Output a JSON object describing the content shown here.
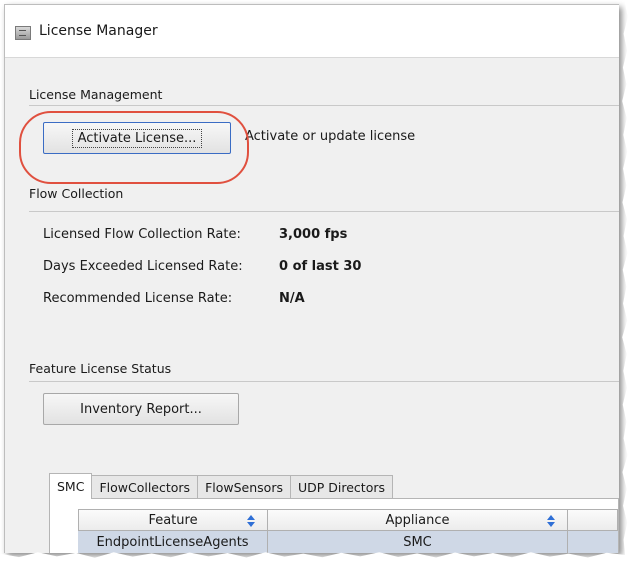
{
  "window": {
    "title": "License Manager"
  },
  "license_management": {
    "heading": "License Management",
    "activate_button": "Activate License...",
    "activate_description": "Activate or update license"
  },
  "flow_collection": {
    "heading": "Flow Collection",
    "rows": [
      {
        "label": "Licensed Flow Collection Rate:",
        "value": "3,000 fps"
      },
      {
        "label": "Days Exceeded Licensed Rate:",
        "value": "0 of last 30"
      },
      {
        "label": "Recommended License Rate:",
        "value": "N/A"
      }
    ]
  },
  "feature_license_status": {
    "heading": "Feature License Status",
    "inventory_button": "Inventory Report...",
    "tabs": [
      "SMC",
      "FlowCollectors",
      "FlowSensors",
      "UDP Directors"
    ],
    "active_tab": "SMC",
    "table": {
      "columns": [
        "Feature",
        "Appliance"
      ],
      "rows": [
        [
          "EndpointLicenseAgents",
          "SMC"
        ]
      ]
    }
  },
  "colors": {
    "highlight_ring": "#e0503f",
    "sort_icon": "#2f6fd6",
    "selected_row": "#cfd8e6"
  },
  "icons": {
    "app": "app-window-icon",
    "sort": "sort-updown-icon"
  }
}
